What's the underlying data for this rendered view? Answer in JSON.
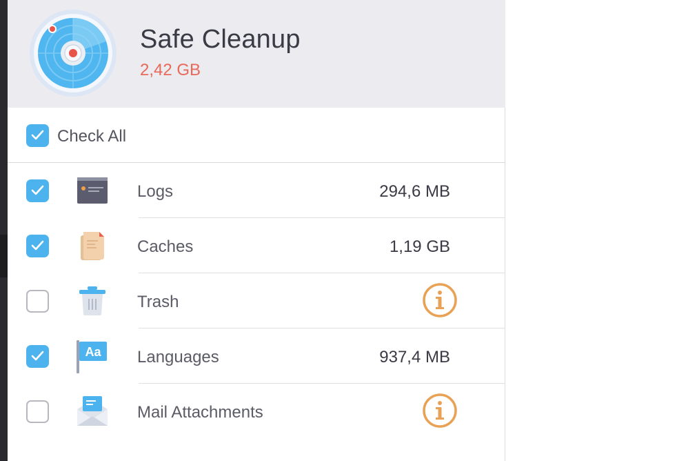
{
  "header": {
    "title": "Safe Cleanup",
    "total_size": "2,42 GB",
    "icon": "radar-scan-icon"
  },
  "check_all": {
    "label": "Check All",
    "checked": true
  },
  "items": [
    {
      "label": "Logs",
      "size": "294,6 MB",
      "checked": true,
      "icon": "logs-card-icon"
    },
    {
      "label": "Caches",
      "size": "1,19 GB",
      "checked": true,
      "icon": "cache-documents-icon"
    },
    {
      "label": "Trash",
      "size": "",
      "checked": false,
      "icon": "trash-icon",
      "info": true
    },
    {
      "label": "Languages",
      "size": "937,4 MB",
      "checked": true,
      "icon": "languages-flag-icon"
    },
    {
      "label": "Mail Attachments",
      "size": "",
      "checked": false,
      "icon": "mail-attachment-icon",
      "info": true
    }
  ],
  "colors": {
    "accent": "#4db3ee",
    "size_red": "#e8695a",
    "info_orange": "#e9a155",
    "header_bg": "#ebebf0"
  }
}
